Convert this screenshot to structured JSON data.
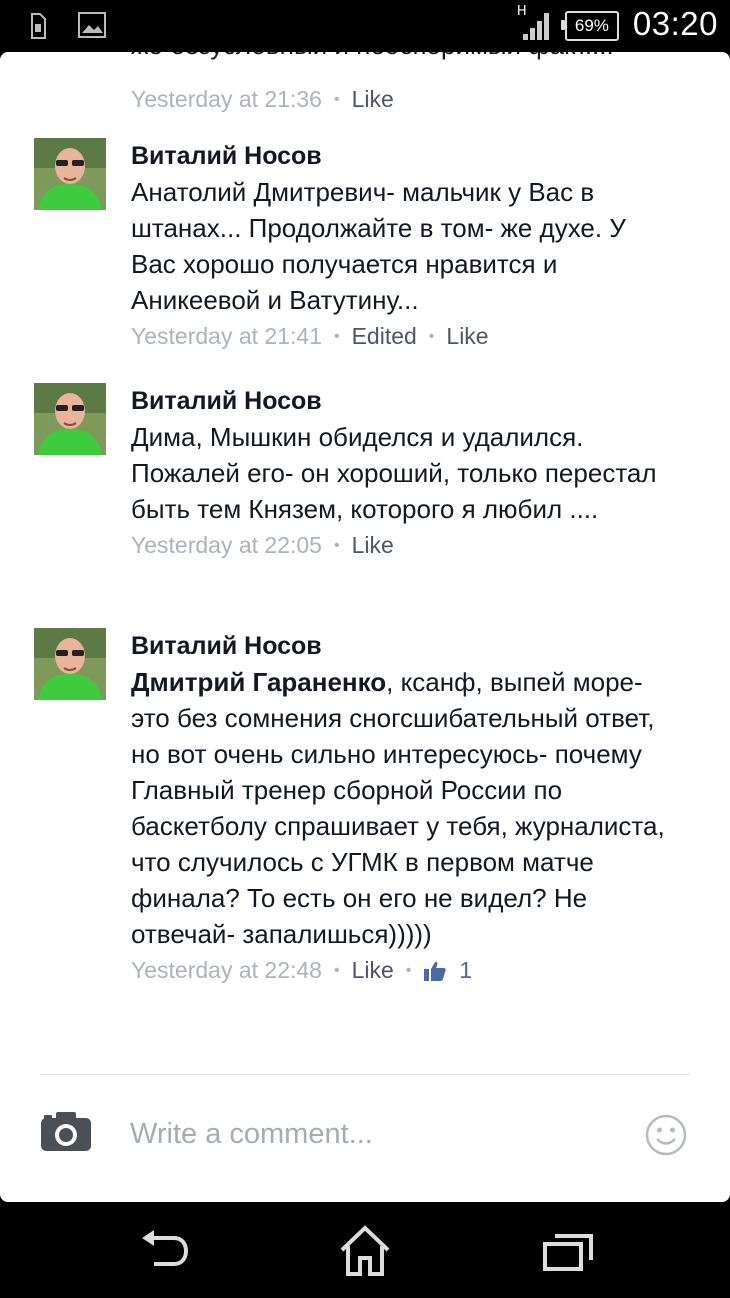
{
  "status_bar": {
    "network_indicator": "H",
    "battery": "69%",
    "time": "03:20",
    "left_icons": [
      "sim-card-icon",
      "image-icon"
    ]
  },
  "previous_comment": {
    "text_tail": "же безусловный и неоспоримый факт....",
    "time": "Yesterday at 21:36",
    "like_label": "Like"
  },
  "comments": [
    {
      "author": "Виталий Носов",
      "text": "Анатолий Дмитревич- мальчик у Вас  в штанах... Продолжайте в том- же духе. У Вас хорошо получается нравится и Аникеевой и Ватутину...",
      "time": "Yesterday at 21:41",
      "edited_label": "Edited",
      "like_label": "Like"
    },
    {
      "author": "Виталий Носов",
      "text": "Дима, Мышкин обиделся и удалился. Пожалей его- он хороший, только перестал быть тем Князем, которого я любил ....",
      "time": "Yesterday at 22:05",
      "like_label": "Like"
    },
    {
      "author": "Виталий Носов",
      "mention": "Дмитрий Гараненко",
      "text": ", ксанф, выпей море- это без сомнения сногсшибательный ответ, но вот очень сильно интересуюсь- почему Главный тренер сборной России по баскетболу спрашивает у тебя, журналиста, что случилось с УГМК в первом матче финала? То есть он его не видел? Не отвечай- запалишься)))))",
      "time": "Yesterday at 22:48",
      "like_label": "Like",
      "like_count": "1"
    }
  ],
  "composer": {
    "placeholder": "Write a comment..."
  },
  "colors": {
    "meta_gray": "#adb2bb",
    "action_gray": "#4e5665",
    "like_blue": "#4e69a2",
    "text": "#141823"
  }
}
